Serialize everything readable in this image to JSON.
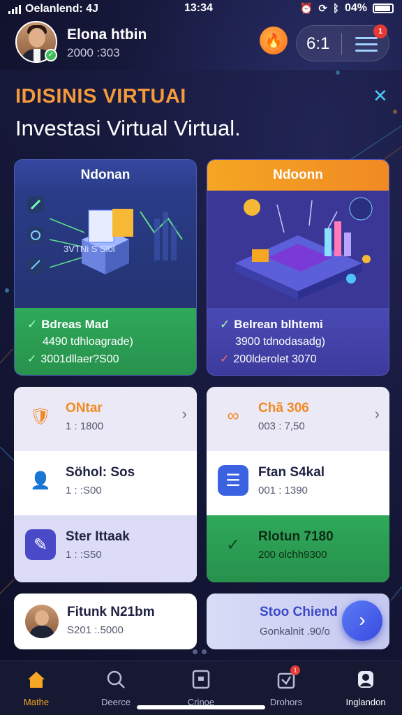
{
  "status_bar": {
    "carrier": "Oelanlend: 4J",
    "time": "13:34",
    "battery": "04%"
  },
  "header": {
    "user_name": "Elona htbin",
    "user_sub": "2000 :303",
    "pill_count": "6:1",
    "menu_badge": "1"
  },
  "banner": {
    "title": "IDISINIS VIRTUAI",
    "subtitle": "Investasi  Virtual Virtual."
  },
  "cards": [
    {
      "header": "Ndonan",
      "art_caption": "3VTNi  S Sl0l",
      "title": "Bdreas Mad",
      "line1": "4490 tdhloagrade)",
      "line2": "3001dllaer?S00"
    },
    {
      "header": "Ndoonn",
      "title": "Belrean blhtemi",
      "line1": "3900 tdnodasadg)",
      "line2": "200lderolet 3070"
    }
  ],
  "list_left": [
    {
      "title": "ONtar",
      "sub": "1 : 1800",
      "icon": "shield-check-icon"
    },
    {
      "title": "Söhol: Sos",
      "sub": "1 : :S00",
      "icon": "user-icon"
    },
    {
      "title": "Ster Ittaak",
      "sub": "1 : :S50",
      "icon": "wand-icon"
    }
  ],
  "list_right": [
    {
      "title": "Chã 306",
      "sub": "003 : 7,50",
      "icon": "link-icon"
    },
    {
      "title": "Ftan S4kal",
      "sub": "001 : 1390",
      "icon": "document-icon"
    },
    {
      "title": "Rlotun 7180",
      "sub": "200 olchh9300",
      "icon": "check-icon"
    }
  ],
  "small_left": {
    "title": "Fitunk N21bm",
    "sub": "S201 :.5000"
  },
  "small_right": {
    "title": "Stoo Chiend",
    "sub": "Gonkalnit .90/o",
    "button": "›"
  },
  "nav": [
    {
      "label": "Mathe",
      "icon": "home-icon",
      "active": true
    },
    {
      "label": "Deerce",
      "icon": "search-icon",
      "active": false
    },
    {
      "label": "Crinoe",
      "icon": "doc-icon",
      "active": false
    },
    {
      "label": "Drohors",
      "icon": "shop-icon",
      "active": false
    },
    {
      "label": "Inglandon",
      "icon": "profile-icon",
      "active": false
    }
  ],
  "colors": {
    "accent_orange": "#f39a3b",
    "accent_blue": "#4fc3f7",
    "success_green": "#2fa95a",
    "card_violet": "#3a3796"
  }
}
